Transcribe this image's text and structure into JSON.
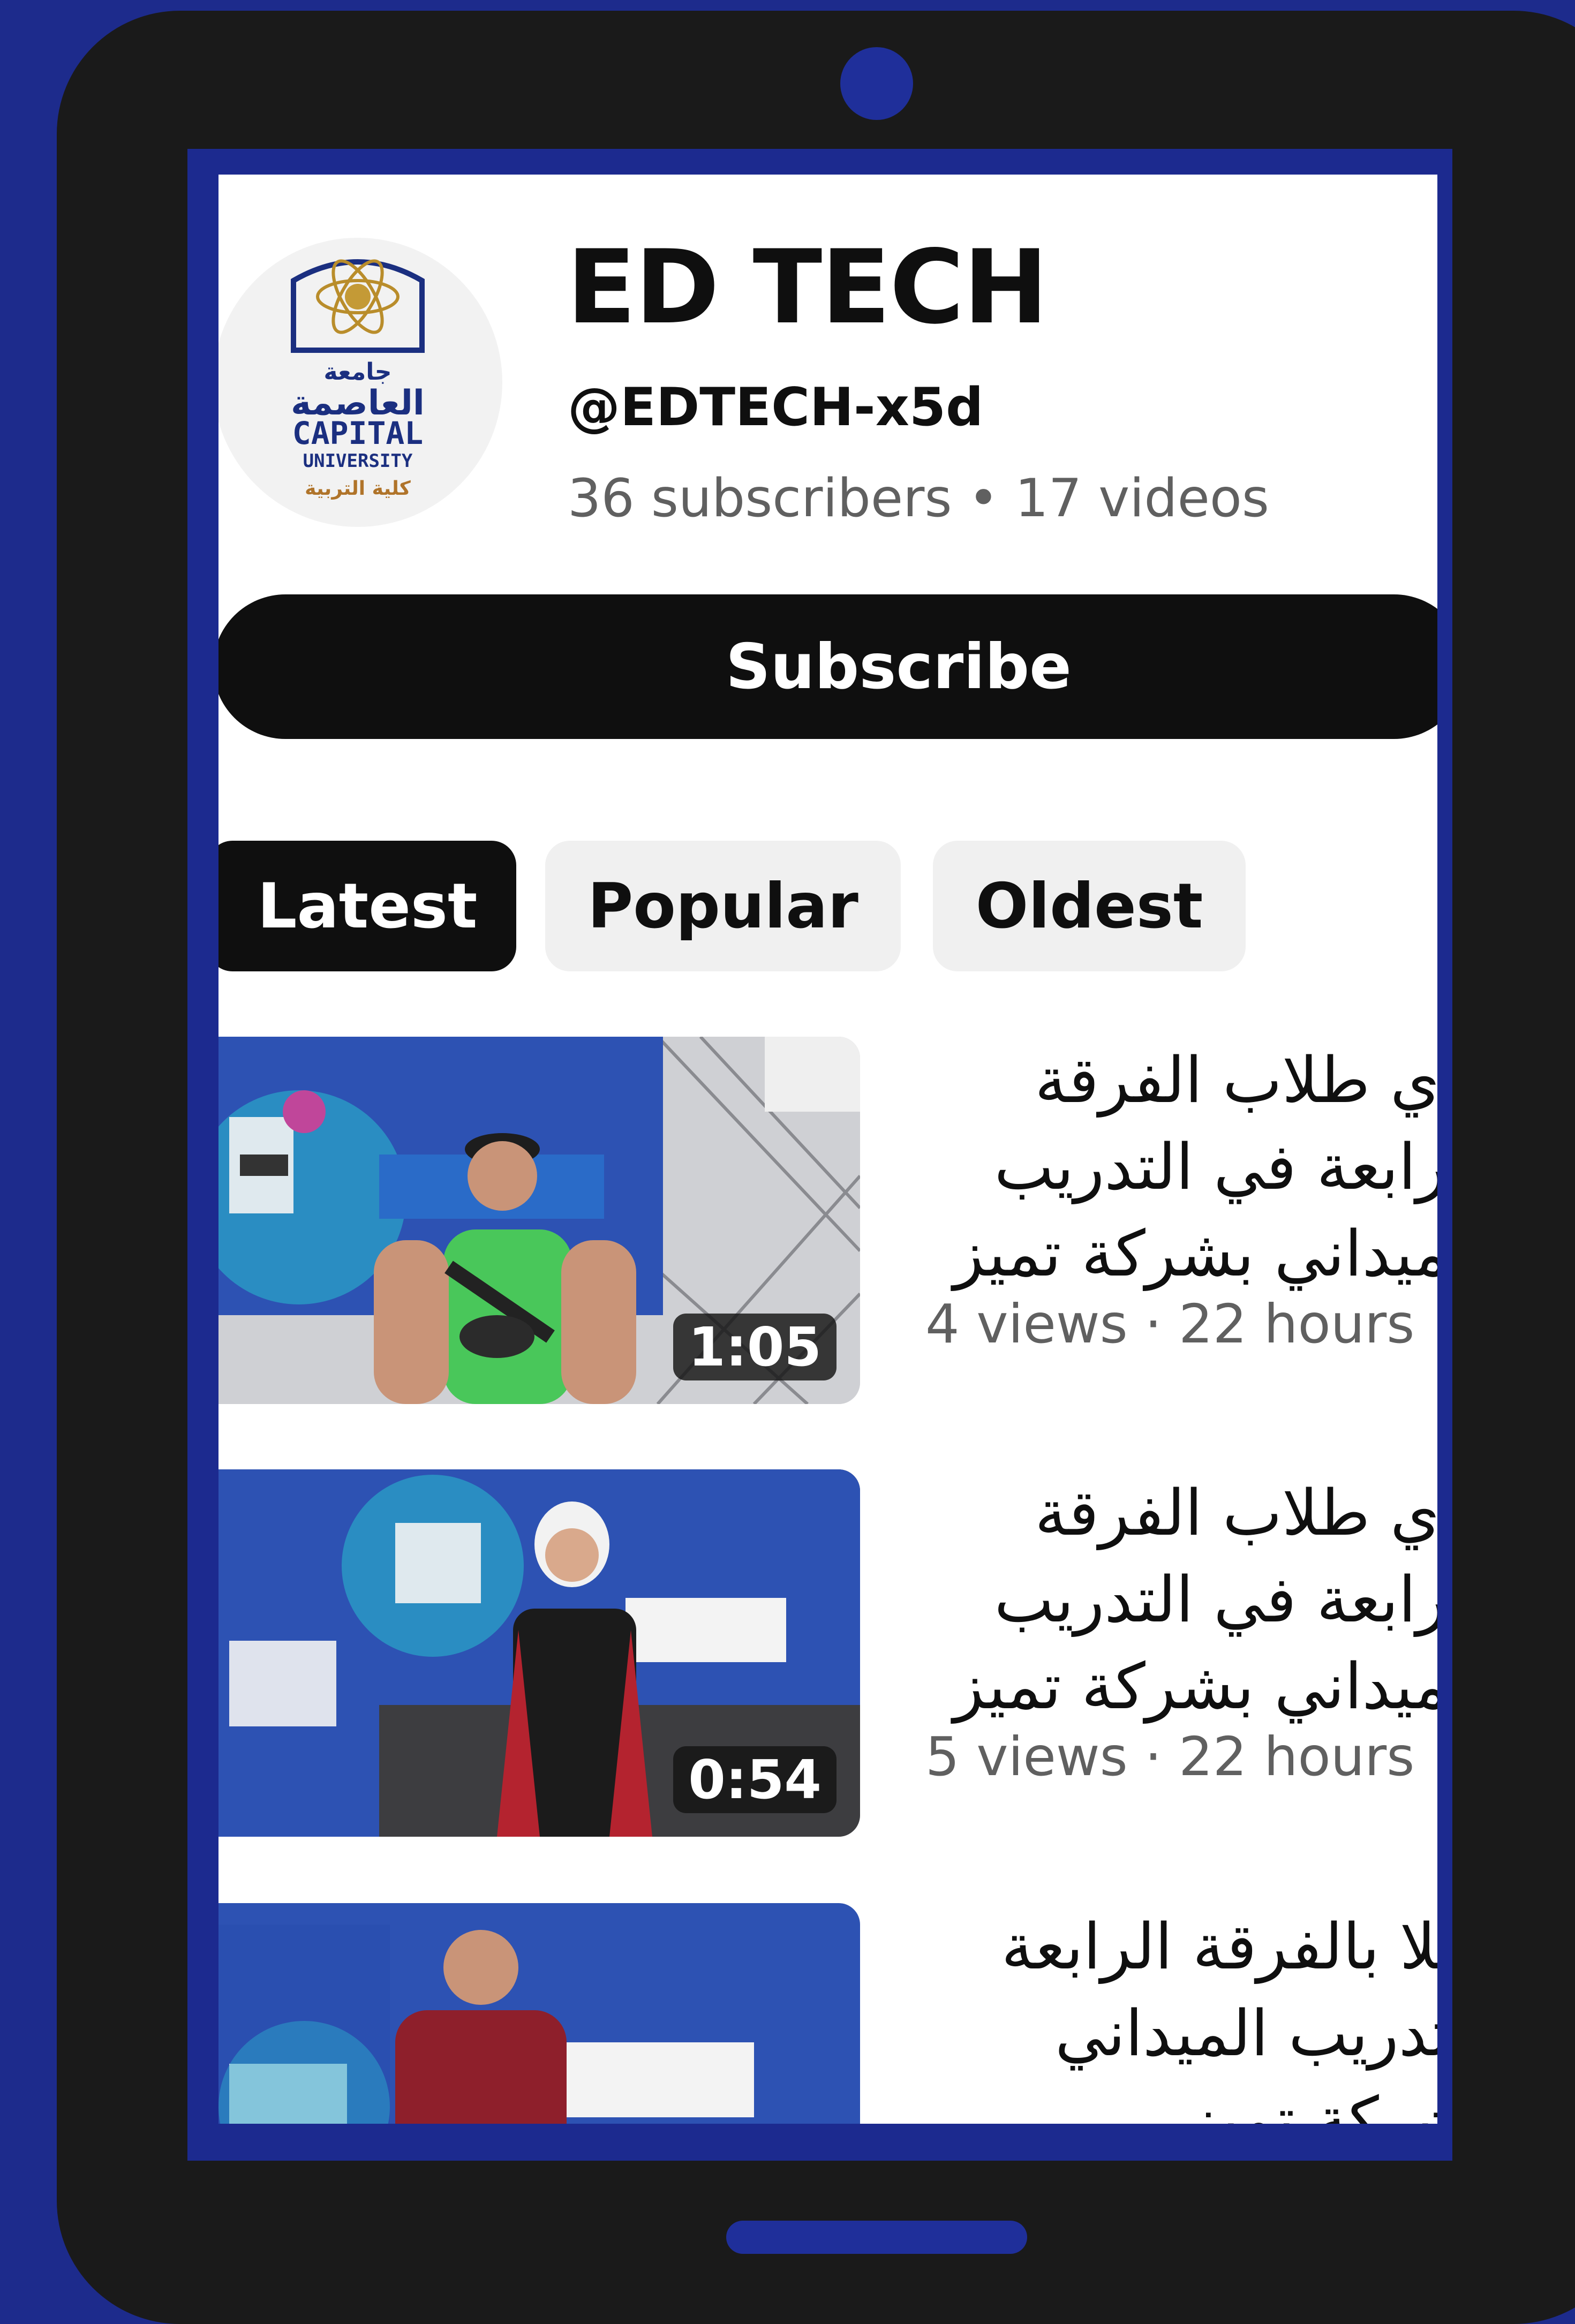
{
  "channel": {
    "name": "ED TECH",
    "handle": "@EDTECH-x5d",
    "subscribers": "36 subscribers",
    "videos": "17 videos",
    "separator": "•",
    "logo": {
      "line1": "جامعة",
      "line2": "العاصمة",
      "line3": "CAPITAL",
      "line4": "UNIVERSITY",
      "line5": "كلية التربية"
    }
  },
  "subscribe_label": "Subscribe",
  "tabs": [
    "Latest",
    "Popular",
    "Oldest"
  ],
  "videos": [
    {
      "title": "رأي طلاب الفرقة\nالرابعة في التدريب\nالميداني بشركة تميز",
      "meta": "4 views · 22 hours",
      "duration": "1:05"
    },
    {
      "title": "رأي طلاب الفرقة\nالرابعة في التدريب\nالميداني بشركة تميز",
      "meta": "5 views · 22 hours",
      "duration": "0:54"
    },
    {
      "title": "طلا بالفرقة الرابعة\nالتدريب الميداني\nبشركة تميز",
      "meta": "",
      "duration": ""
    }
  ],
  "colors": {
    "background": "#1d2b8c",
    "device": "#1a1a1a",
    "accent": "#0f0f0f",
    "secondary_text": "#606060"
  }
}
